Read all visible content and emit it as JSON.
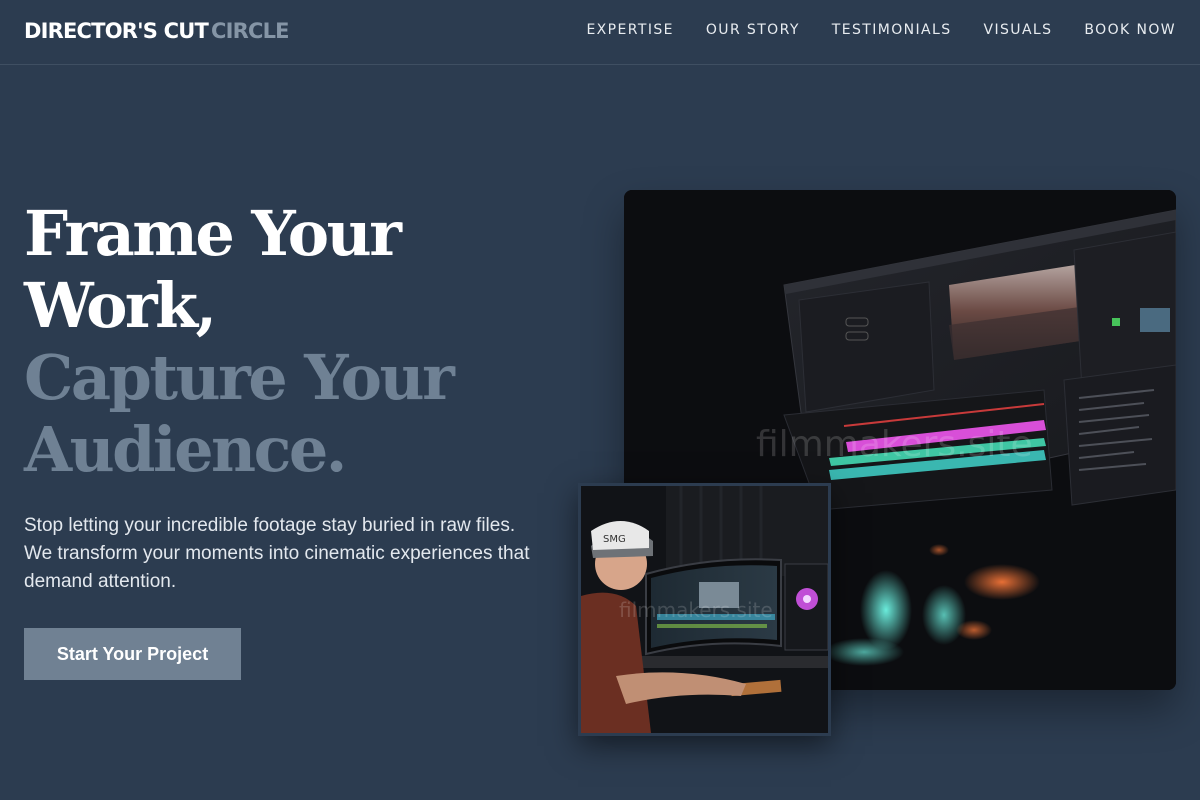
{
  "nav": {
    "logo_primary": "DIRECTOR'S CUT",
    "logo_secondary": "CIRCLE",
    "links": [
      {
        "label": "EXPERTISE"
      },
      {
        "label": "OUR STORY"
      },
      {
        "label": "TESTIMONIALS"
      },
      {
        "label": "VISUALS"
      },
      {
        "label": "BOOK NOW"
      }
    ]
  },
  "hero": {
    "headline": {
      "line1": "Frame Your",
      "line2": "Work,",
      "line3": "Capture Your",
      "line4": "Audience."
    },
    "subtext": "Stop letting your incredible footage stay buried in raw files. We transform your moments into cinematic experiences that demand attention.",
    "cta_label": "Start Your Project"
  },
  "images": {
    "main_watermark": "filmmakers.site",
    "inset_watermark": "filmmakers.site"
  },
  "colors": {
    "background": "#2c3c50",
    "muted_text": "#6f8194",
    "button": "#708193"
  }
}
